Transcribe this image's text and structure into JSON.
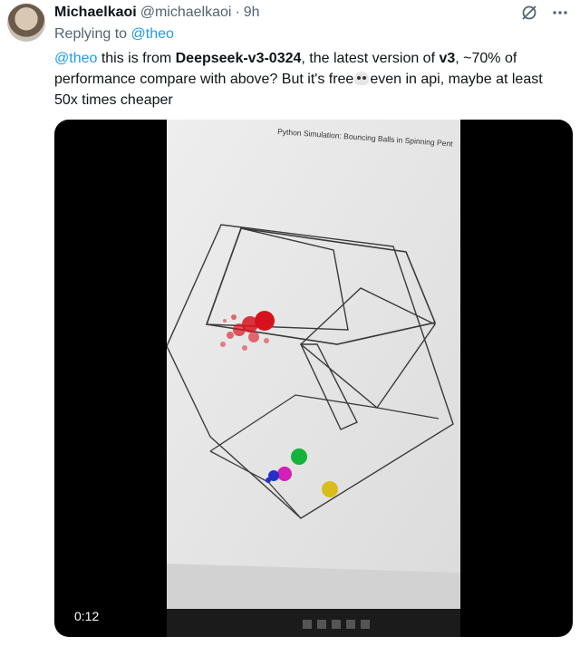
{
  "author": {
    "display_name": "Michaelkaoi",
    "handle": "@michaelkaoi",
    "separator": "·",
    "time": "9h"
  },
  "icons": {
    "grok": "slashed-circle-icon",
    "more": "more-icon"
  },
  "reply": {
    "prefix": "Replying to",
    "mention": "@theo"
  },
  "text": {
    "mention": "@theo",
    "part1": " this is from ",
    "model": "Deepseek-v3-0324",
    "part2": ", the latest version of ",
    "version": "v3",
    "part3": ", ~70% of performance compare with above? But it's free",
    "part4": "even in api, maybe at least 50x times cheaper"
  },
  "video": {
    "screen_title": "Python Simulation: Bouncing Balls in Spinning Pent",
    "duration": "0:12"
  },
  "colors": {
    "link": "#1d9bf0",
    "secondary": "#536471",
    "ball_red": "#d8121c",
    "ball_green": "#14b33a",
    "ball_magenta": "#d41fb8",
    "ball_blue": "#2430c8",
    "ball_yellow": "#d8bd1a"
  }
}
